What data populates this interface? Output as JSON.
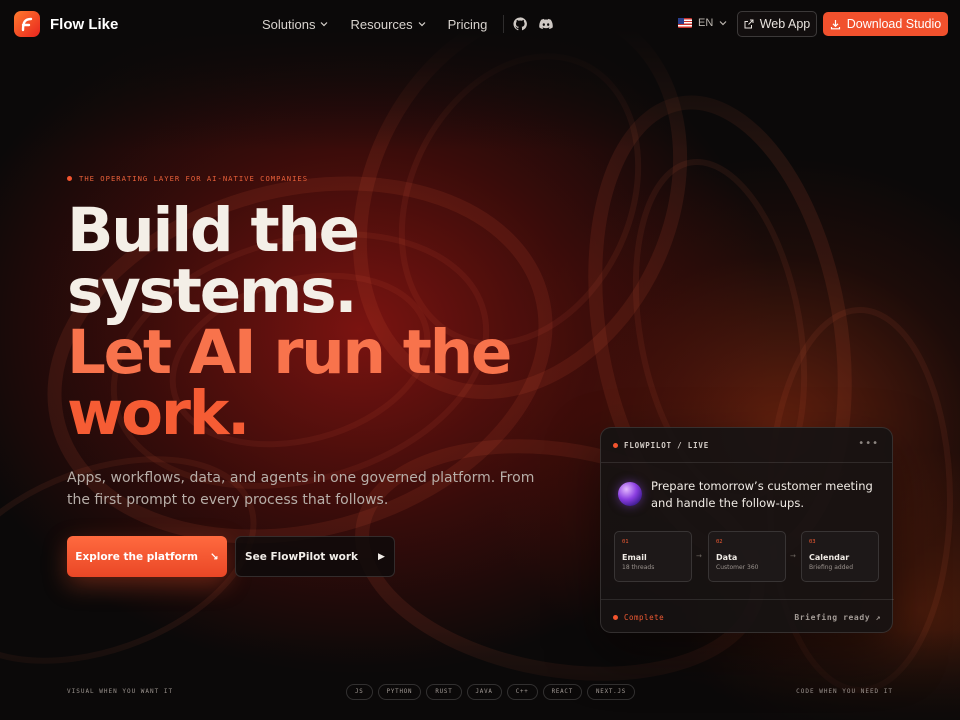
{
  "nav": {
    "brand": "Flow Like",
    "menu": [
      {
        "label": "Solutions",
        "has_dropdown": true
      },
      {
        "label": "Resources",
        "has_dropdown": true
      },
      {
        "label": "Pricing",
        "has_dropdown": false
      }
    ],
    "icons": [
      "github-icon",
      "discord-icon"
    ],
    "language": "EN",
    "web_app_label": "Web App",
    "download_label": "Download Studio",
    "accent_color": "#f1512d"
  },
  "hero": {
    "eyebrow": "THE OPERATING LAYER FOR AI-NATIVE COMPANIES",
    "headline_lines": [
      "Build the",
      "systems.",
      "Let AI run the",
      "work."
    ],
    "subtext": "Apps, workflows, data, and agents in one governed platform. From the first prompt to every process that follows.",
    "primary_cta": "Explore the platform",
    "primary_cta_icon": "↘",
    "secondary_cta": "See FlowPilot work",
    "secondary_cta_icon": "▶"
  },
  "card": {
    "title": "FLOWPILOT / LIVE",
    "more": "•••",
    "prompt": "Prepare tomorrow’s customer meeting and handle the follow-ups.",
    "steps": [
      {
        "num": "01",
        "name": "Email",
        "meta": "18 threads"
      },
      {
        "num": "02",
        "name": "Data",
        "meta": "Customer 360"
      },
      {
        "num": "03",
        "name": "Calendar",
        "meta": "Briefing added"
      }
    ],
    "arrow": "→",
    "status": "Complete",
    "result": "Briefing ready ↗"
  },
  "footer_strip": {
    "left": "VISUAL WHEN YOU WANT IT",
    "right": "CODE WHEN YOU NEED IT",
    "tech": [
      "JS",
      "PYTHON",
      "RUST",
      "JAVA",
      "C++",
      "REACT",
      "NEXT.JS"
    ]
  }
}
